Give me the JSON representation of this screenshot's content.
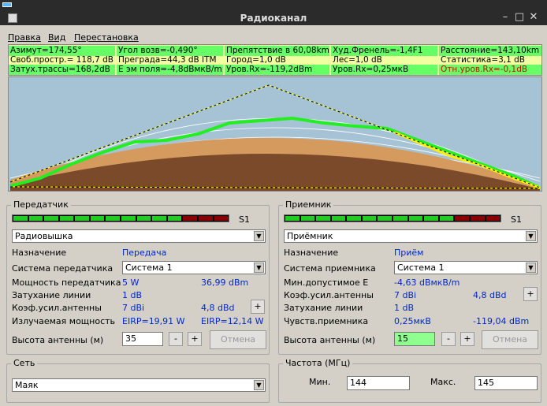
{
  "window": {
    "title": "Радиоканал"
  },
  "menu": [
    "Правка",
    "Вид",
    "Перестановка"
  ],
  "info": [
    [
      "Азимут=174,55°",
      "Угол возв=-0,490°",
      "Препятствие в 60,08km",
      "Худ.Френель=-1,4F1",
      "Расстояние=143,10km"
    ],
    [
      "Своб.простр.= 118,7 dB",
      "Преграда=44,3 dB ITM",
      "Город=1,0 dB",
      "Лес=1,0 dB",
      "Статистика=3,1 dB"
    ],
    [
      "Затух.трассы=168,2dB",
      "Е эм поля=-4,8dBмкВ/m",
      "Уров.Rx=-119,2dBm",
      "Уров.Rx=0,25мкВ",
      "Отн.уров.Rx=-0,1dB"
    ]
  ],
  "colors": {
    "accent_red": "#e00000",
    "link_blue": "#0028c8",
    "highlight": "#66ff66",
    "sky": "#a6c3d6",
    "terrain": "#7a4a2a"
  },
  "tx": {
    "legend": "Передатчик",
    "meter_label": "S1",
    "station": "Радиовышка",
    "purpose_label": "Назначение",
    "purpose_value": "Передача",
    "system_label": "Система передатчика",
    "system_value": "Система  1",
    "power_label": "Мощность передатчика",
    "power_w": "5 W",
    "power_dbm": "36,99 dBm",
    "loss_label": "Затухание линии",
    "loss_value": "1 dB",
    "gain_label": "Коэф.усил.антенны",
    "gain_dbi": "7 dBi",
    "gain_dbd": "4,8 dBd",
    "eirp_label": "Излучаемая мощность",
    "eirp_w": "EIRP=19,91 W",
    "eirp_w2": "EIRP=12,14 W",
    "height_label": "Высота антенны (м)",
    "height_value": "35",
    "minus": "-",
    "plus": "+",
    "cancel": "Отмена"
  },
  "rx": {
    "legend": "Приемник",
    "meter_label": "S1",
    "station": "Приёмник",
    "purpose_label": "Назначение",
    "purpose_value": "Приём",
    "system_label": "Система приемника",
    "system_value": "Система   1",
    "mine_label": "Мин.допустимое Е",
    "mine_value": "-4,63 dBмкВ/m",
    "gain_label": "Коэф.усил.антенны",
    "gain_dbi": "7 dBi",
    "gain_dbd": "4,8 dBd",
    "loss_label": "Затухание линии",
    "loss_value": "1 dB",
    "sens_label": "Чувств.приемника",
    "sens_uv": "0,25мкВ",
    "sens_dbm": "-119,04 dBm",
    "height_label": "Высота антенны (м)",
    "height_value": "15",
    "minus": "-",
    "plus": "+",
    "cancel": "Отмена"
  },
  "net": {
    "legend": "Сеть",
    "value": "Маяк"
  },
  "freq": {
    "legend": "Частота (МГц)",
    "min_label": "Мин.",
    "min_value": "144",
    "max_label": "Макс.",
    "max_value": "145"
  },
  "meter_colors": [
    "#22cc22",
    "#22cc22",
    "#22cc22",
    "#22cc22",
    "#22cc22",
    "#22cc22",
    "#22cc22",
    "#22cc22",
    "#22cc22",
    "#22cc22",
    "#22cc22",
    "#880000",
    "#880000",
    "#880000"
  ]
}
